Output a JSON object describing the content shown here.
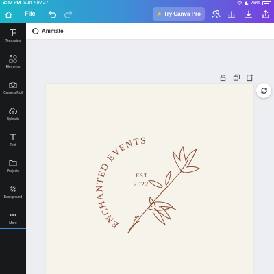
{
  "status_bar": {
    "time": "3:47 PM",
    "date": "Sun Nov 27",
    "battery": "78%",
    "icons": [
      "wifi-icon",
      "moon-icon",
      "battery-icon"
    ]
  },
  "toolbar": {
    "file_label": "File",
    "pro_label": "Try Canva Pro",
    "icons": [
      "home-icon",
      "undo-icon",
      "redo-icon",
      "crown-star-icon",
      "people-icon",
      "chart-icon",
      "download-icon",
      "share-icon"
    ]
  },
  "sidebar": {
    "items": [
      {
        "label": "Templates",
        "icon": "templates-icon"
      },
      {
        "label": "Elements",
        "icon": "elements-icon"
      },
      {
        "label": "Camera Roll",
        "icon": "camera-icon"
      },
      {
        "label": "Uploads",
        "icon": "upload-icon"
      },
      {
        "label": "Text",
        "icon": "text-icon"
      },
      {
        "label": "Projects",
        "icon": "folder-icon"
      },
      {
        "label": "Background",
        "icon": "background-icon"
      },
      {
        "label": "More",
        "icon": "more-icon"
      }
    ]
  },
  "animate": {
    "label": "Animate"
  },
  "page_tools": [
    "lock-icon",
    "duplicate-icon",
    "add-page-icon",
    "refresh-icon"
  ],
  "design": {
    "arc_text": "ENCHANTED EVENTS",
    "est_text": "EST",
    "year_text": "2022",
    "color": "#8a4a35"
  }
}
